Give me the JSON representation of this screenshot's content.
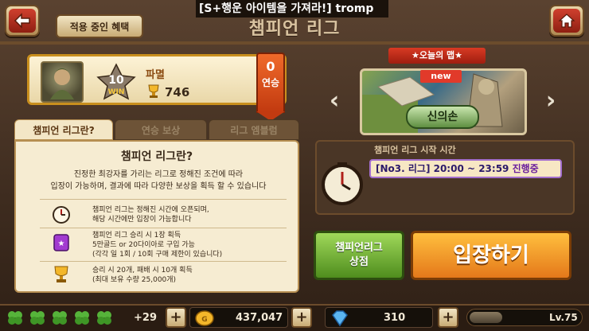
{
  "header": {
    "back_label": "back",
    "applied_benefits": "적용 중인 혜택",
    "ticker": "[S+행운 아이템을 가져라!] tromp",
    "title": "챔피언 리그",
    "home_label": "home"
  },
  "profile": {
    "rank_wins": "10",
    "rank_suffix": "WIN",
    "rank_name": "파멸",
    "trophies": "746",
    "streak_count": "0",
    "streak_label": "연승"
  },
  "tabs": [
    {
      "label": "챔피언 리그란?",
      "active": true
    },
    {
      "label": "연승 보상",
      "active": false
    },
    {
      "label": "리그 엠블럼",
      "active": false
    }
  ],
  "info": {
    "title": "챔피언 리그란?",
    "desc_line1": "진정한 최강자를 가리는 리그로 정해진 조건에 따라",
    "desc_line2": "입장이 가능하며, 결과에 따라 다양한 보상을 획득 할 수 있습니다",
    "rules": [
      {
        "icon": "clock-icon",
        "line1": "챔피언 리그는 정해진 시간에 오픈되며,",
        "line2": "해당 시간에만 입장이 가능합니다",
        "line3": ""
      },
      {
        "icon": "ticket-icon",
        "line1": "챔피언 리그 승리 시 1장 획득",
        "line2": "5만골드 or 20다이아로 구입 가능",
        "line3": "(각각 일 1회 / 10회 구매 제한이 있습니다)"
      },
      {
        "icon": "trophy-icon",
        "line1": "승리 시 20개, 패배 시 10개 획득",
        "line2": "(최대 보유 수량 25,000개)",
        "line3": ""
      }
    ]
  },
  "map": {
    "ribbon": "★오늘의 맵★",
    "new_tag": "new",
    "name": "신의손"
  },
  "schedule": {
    "label": "챔피언 리그 시작 시간",
    "slot": "[No3. 리그] 20:00 ~ 23:59",
    "status": "진행중"
  },
  "actions": {
    "shop_line1": "챔피언리그",
    "shop_line2": "상점",
    "enter": "입장하기"
  },
  "bottom": {
    "clover_count": "+29",
    "gold": "437,047",
    "diamonds": "310",
    "level": "Lv.75",
    "level_progress": 0.3
  }
}
